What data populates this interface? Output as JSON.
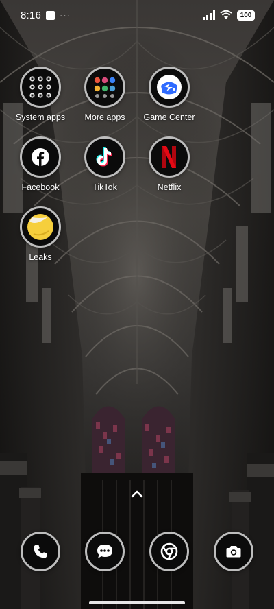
{
  "status_bar": {
    "time": "8:16",
    "battery": "100",
    "icons": [
      "notification-square-icon",
      "more-dots-icon",
      "signal-icon",
      "wifi-icon",
      "battery-icon"
    ]
  },
  "apps": {
    "system_apps": "System apps",
    "more_apps": "More apps",
    "game_center": "Game Center",
    "facebook": "Facebook",
    "tiktok": "TikTok",
    "netflix": "Netflix",
    "leaks": "Leaks"
  },
  "dock": {
    "icons": [
      "phone-icon",
      "messages-icon",
      "chrome-icon",
      "camera-icon"
    ]
  },
  "colors": {
    "icon_bg": "#0b0b0b",
    "icon_ring": "#bdbdbd",
    "facebook_blue": "#1877f2",
    "netflix_red": "#e50914",
    "tiktok_cyan": "#25f4ee",
    "tiktok_pink": "#fe2c55",
    "leaks_yellow": "#f6cf3c",
    "game_center_blue": "#2f6bff"
  },
  "misc": {
    "more_dots": "···"
  }
}
